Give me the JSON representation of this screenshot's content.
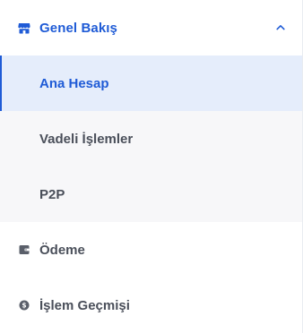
{
  "colors": {
    "accent": "#1f5bd6",
    "active_background": "#e5edfb",
    "submenu_background": "#f7f7f9",
    "text_muted": "#4a4f5a",
    "icon_muted": "#5a5f6a"
  },
  "sidebar": {
    "group": {
      "label": "Genel Bakış",
      "icon": "storefront-icon",
      "expanded": true,
      "chevron_icon": "chevron-up-icon"
    },
    "sub_items": [
      {
        "label": "Ana Hesap",
        "active": true
      },
      {
        "label": "Vadeli İşlemler",
        "active": false
      },
      {
        "label": "P2P",
        "active": false
      }
    ],
    "items": [
      {
        "label": "Ödeme",
        "icon": "wallet-icon"
      },
      {
        "label": "İşlem Geçmişi",
        "icon": "dollar-coin-icon"
      }
    ]
  }
}
